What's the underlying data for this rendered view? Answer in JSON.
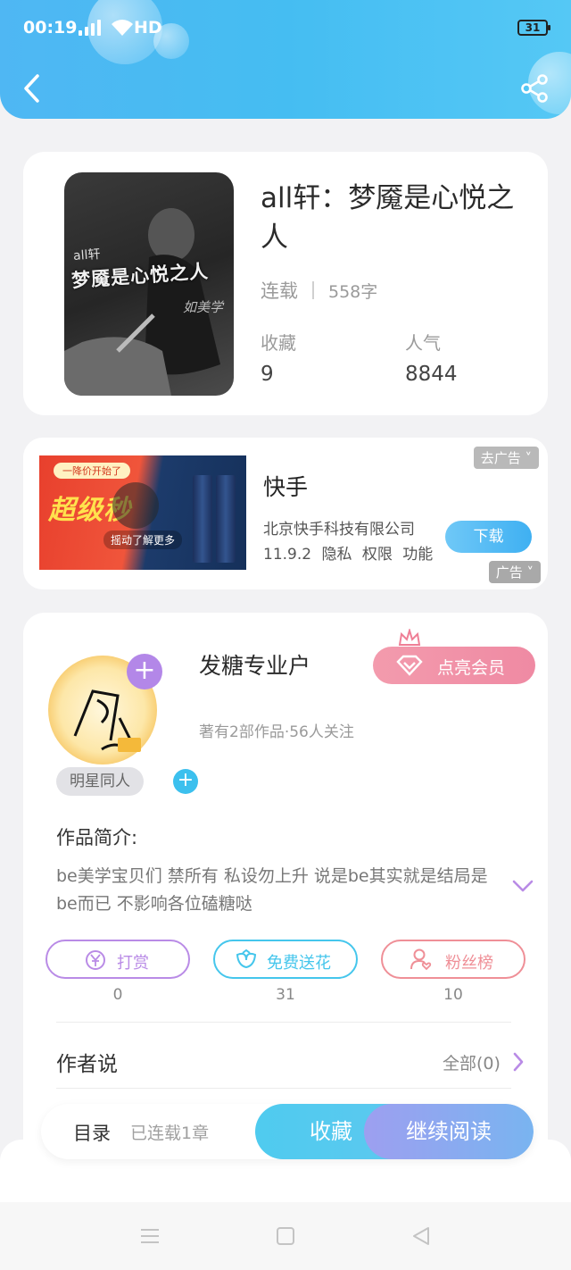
{
  "status_bar": {
    "time": "00:19",
    "network": "4G",
    "hd": "HD",
    "battery": "31"
  },
  "book": {
    "title": "all轩：梦魇是心悦之人",
    "cover_title": "梦魇是心悦之人",
    "cover_prefix": "all轩",
    "cover_sign": "如美学",
    "status": "连载",
    "words": "558字",
    "favorites_label": "收藏",
    "favorites": "9",
    "popularity_label": "人气",
    "popularity": "8844"
  },
  "ad": {
    "app_name": "快手",
    "company": "北京快手科技有限公司",
    "info": "11.9.2 隐私 权限 功能",
    "download_label": "下载",
    "remove_ad_label": "去广告",
    "ad_label": "广告",
    "image_pill": "一降价开始了",
    "image_promo": "超级秒",
    "image_shake": "摇动了解更多"
  },
  "author": {
    "name": "发糖专业户",
    "sub": "著有2部作品·56人关注",
    "vip_label": "点亮会员",
    "tag": "明星同人",
    "intro_label": "作品简介:",
    "intro_text": "be美学宝贝们 禁所有 私设勿上升 说是be其实就是结局是be而已 不影响各位磕糖哒",
    "actions": [
      {
        "label": "打赏",
        "count": "0",
        "color": "#b98be6"
      },
      {
        "label": "免费送花",
        "count": "31",
        "color": "#45c6ec"
      },
      {
        "label": "粉丝榜",
        "count": "10",
        "color": "#ef8f97"
      }
    ],
    "author_says_label": "作者说",
    "all_label": "全部(0)"
  },
  "bottom_bar": {
    "toc_label": "目录",
    "chapters_label": "已连载1章",
    "favorite_label": "收藏",
    "continue_label": "继续阅读"
  },
  "icons": [
    "back-icon",
    "share-icon",
    "plus-icon",
    "crown-icon",
    "diamond-icon",
    "chevron-down-icon",
    "yen-icon",
    "flower-icon",
    "fan-icon",
    "chevron-right-icon",
    "menu-icon",
    "home-icon",
    "nav-back-icon"
  ]
}
